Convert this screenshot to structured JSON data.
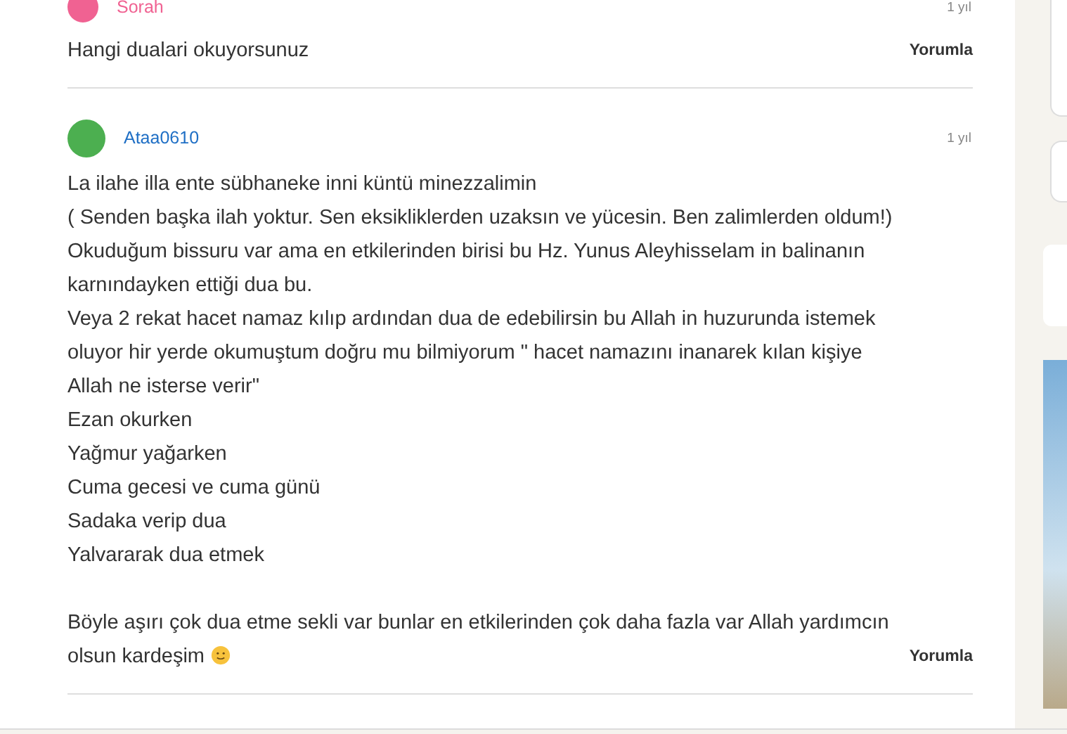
{
  "posts": [
    {
      "author": "Sorah",
      "color": "#f06292",
      "time": "1 yıl",
      "body": [
        [
          "Hangi dualari okuyorsunuz"
        ]
      ],
      "emoji": false,
      "action": "Yorumla"
    },
    {
      "author": "Ataa0610",
      "color": "#4caf50",
      "time": "1 yıl",
      "body": [
        [
          "La ilahe illa ente sübhaneke inni küntü minezzalimin",
          "( Senden başka ilah yoktur. Sen eksikliklerden uzaksın ve yücesin. Ben zalimlerden oldum!)",
          "Okuduğum bissuru var ama en etkilerinden birisi bu Hz. Yunus Aleyhisselam in balinanın karnındayken ettiği dua bu.",
          "Veya 2 rekat hacet namaz kılıp ardından dua de edebilirsin bu Allah in huzurunda istemek oluyor hir yerde okumuştum doğru mu bilmiyorum \" hacet namazını inanarek kılan kişiye Allah ne isterse verir\"",
          "Ezan okurken",
          "Yağmur yağarken",
          "Cuma gecesi ve cuma günü",
          "Sadaka verip dua",
          "Yalvararak dua etmek"
        ],
        [
          "Böyle aşırı çok dua etme sekli var bunlar en etkilerinden çok daha fazla var Allah yardımcın olsun kardeşim"
        ]
      ],
      "emoji": true,
      "action": "Yorumla"
    }
  ]
}
